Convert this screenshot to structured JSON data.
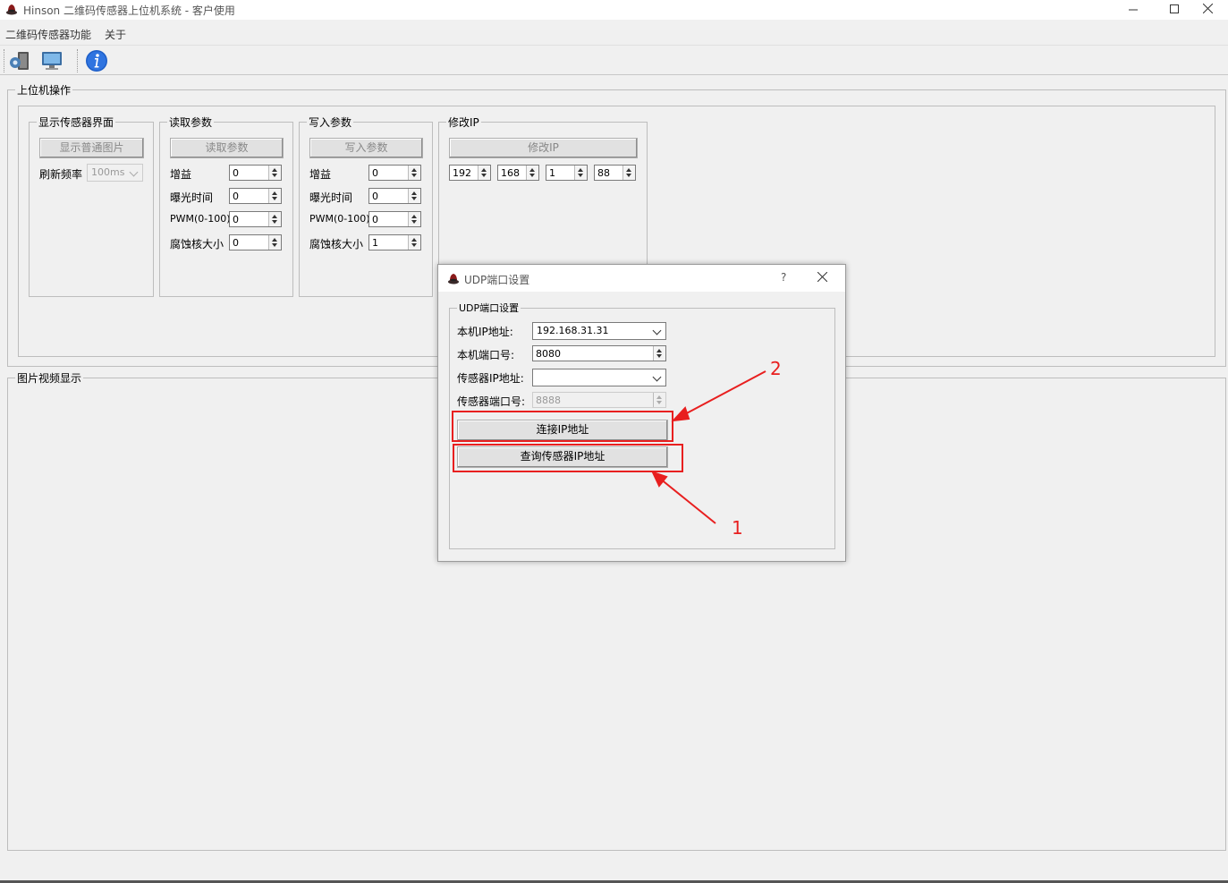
{
  "window": {
    "title": "Hinson 二维码传感器上位机系统 - 客户使用"
  },
  "menu": {
    "items": [
      "二维码传感器功能",
      "关于"
    ]
  },
  "toolbar": {
    "icons": [
      "settings-icon",
      "monitor-icon",
      "info-icon"
    ]
  },
  "host_ops": {
    "title": "上位机操作",
    "display": {
      "title": "显示传感器界面",
      "button": "显示普通图片",
      "refresh_label": "刷新频率",
      "refresh_value": "100ms"
    },
    "read": {
      "title": "读取参数",
      "button": "读取参数",
      "gain_label": "增益",
      "gain": "0",
      "exposure_label": "曝光时间",
      "exposure": "0",
      "pwm_label": "PWM(0-100)",
      "pwm": "0",
      "erode_label": "腐蚀核大小",
      "erode": "0"
    },
    "write": {
      "title": "写入参数",
      "button": "写入参数",
      "gain_label": "增益",
      "gain": "0",
      "exposure_label": "曝光时间",
      "exposure": "0",
      "pwm_label": "PWM(0-100)",
      "pwm": "0",
      "erode_label": "腐蚀核大小",
      "erode": "1"
    },
    "modify_ip": {
      "title": "修改IP",
      "button": "修改IP",
      "octets": [
        "192",
        "168",
        "1",
        "88"
      ]
    }
  },
  "video": {
    "title": "图片视频显示"
  },
  "dialog": {
    "title": "UDP端口设置",
    "help": "?",
    "group_title": "UDP端口设置",
    "local_ip_label": "本机IP地址:",
    "local_ip": "192.168.31.31",
    "local_port_label": "本机端口号:",
    "local_port": "8080",
    "sensor_ip_label": "传感器IP地址:",
    "sensor_ip": "",
    "sensor_port_label": "传感器端口号:",
    "sensor_port": "8888",
    "connect_button": "连接IP地址",
    "query_button": "查询传感器IP地址"
  },
  "annotations": {
    "label_connect": "2",
    "label_query": "1",
    "color": "#e81f1f"
  }
}
